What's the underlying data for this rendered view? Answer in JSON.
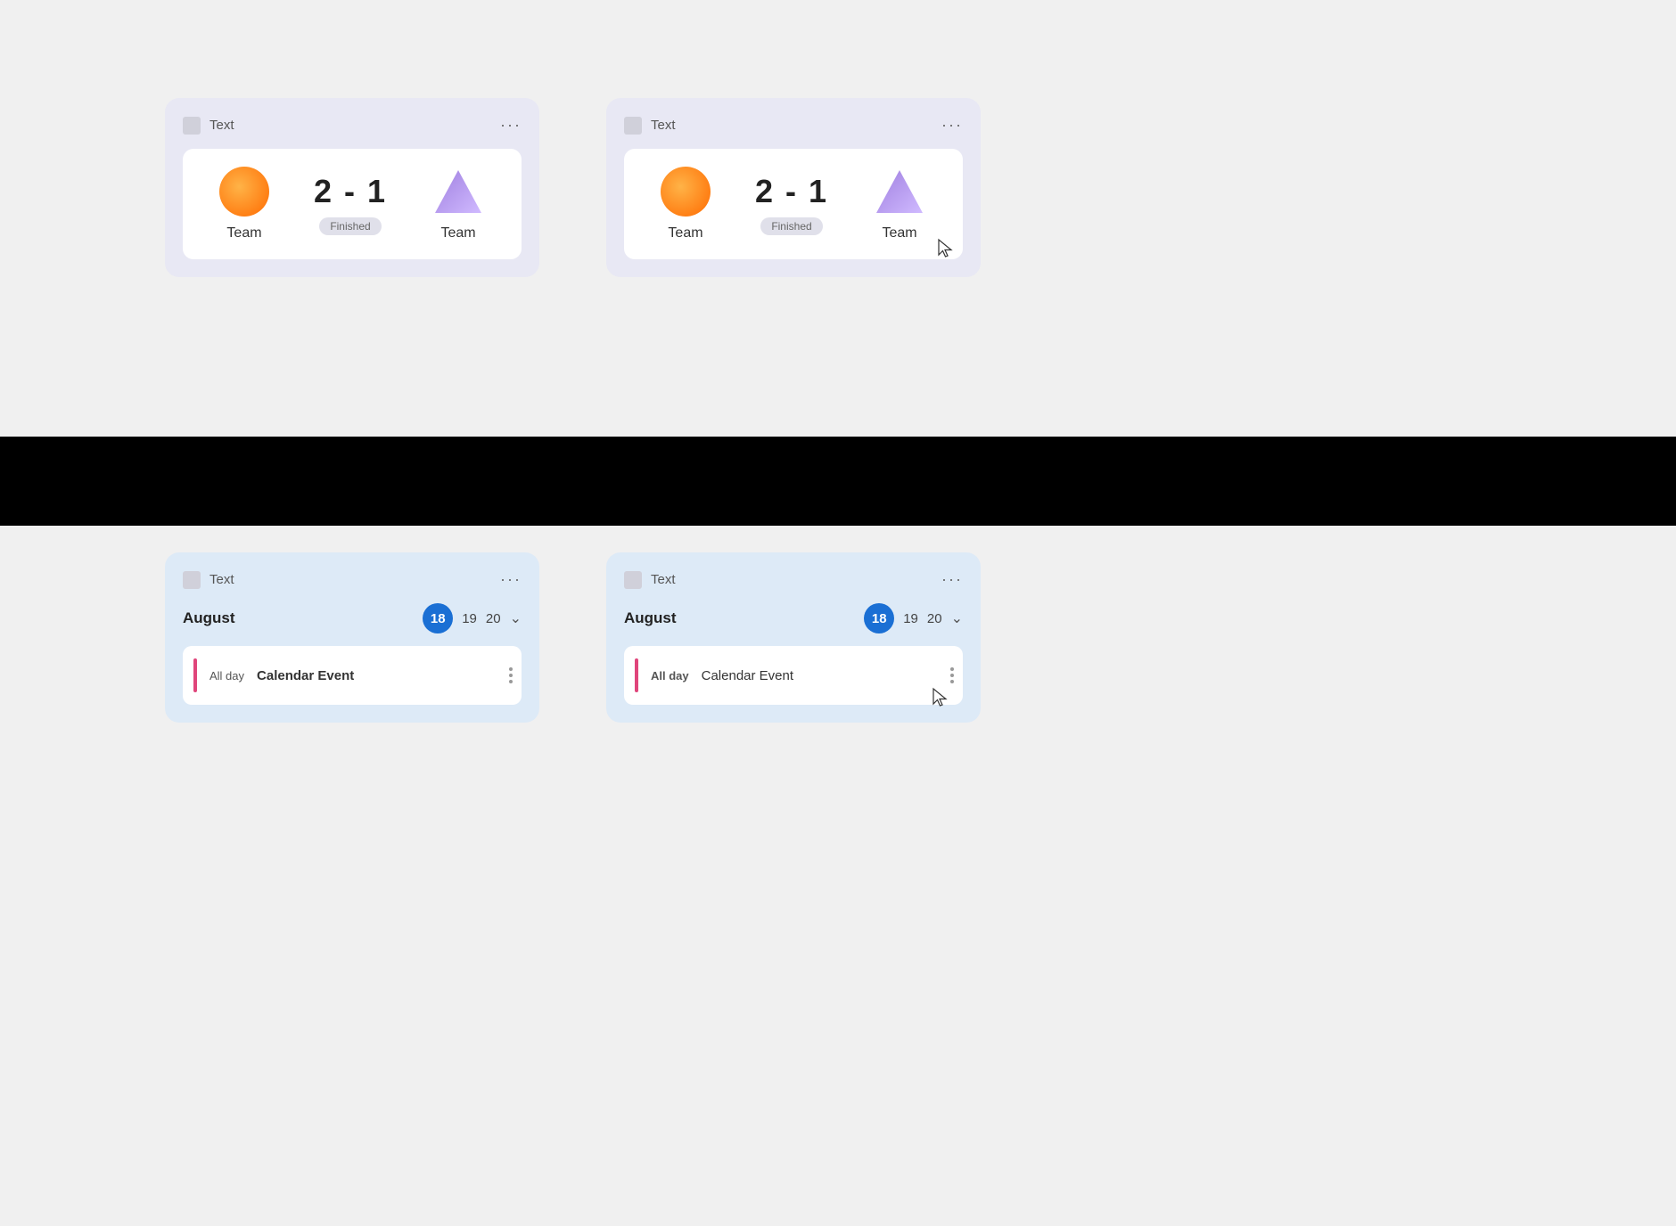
{
  "colors": {
    "background_top": "#f0f0f0",
    "background_bottom": "#f0f0f0",
    "black_band": "#000000",
    "score_card_bg": "#e8e8f4",
    "calendar_card_bg": "#ddeaf7",
    "score_inner_bg": "#ffffff",
    "event_row_bg": "#ffffff",
    "finished_badge_bg": "#e0e0ea",
    "date_bubble_bg": "#1a6fd4",
    "event_bar_color": "#e0457b",
    "team1_gradient_start": "#ffb347",
    "team1_gradient_end": "#ff6a00",
    "team2_triangle_top": "#8a6fcc",
    "team2_triangle_bottom": "#c0aaee"
  },
  "card_top_left": {
    "header_title": "Text",
    "more_label": "···",
    "team1_label": "Team",
    "team2_label": "Team",
    "score": "2 - 1",
    "status": "Finished"
  },
  "card_top_right": {
    "header_title": "Text",
    "more_label": "···",
    "team1_label": "Team",
    "team2_label": "Team",
    "score": "2 - 1",
    "status": "Finished"
  },
  "card_bottom_left": {
    "header_title": "Text",
    "more_label": "···",
    "month": "August",
    "date_active": "18",
    "date2": "19",
    "date3": "20",
    "allday_label": "All day",
    "event_name": "Calendar Event"
  },
  "card_bottom_right": {
    "header_title": "Text",
    "more_label": "···",
    "month": "August",
    "date_active": "18",
    "date2": "19",
    "date3": "20",
    "allday_label": "All day",
    "event_name": "Calendar Event"
  }
}
